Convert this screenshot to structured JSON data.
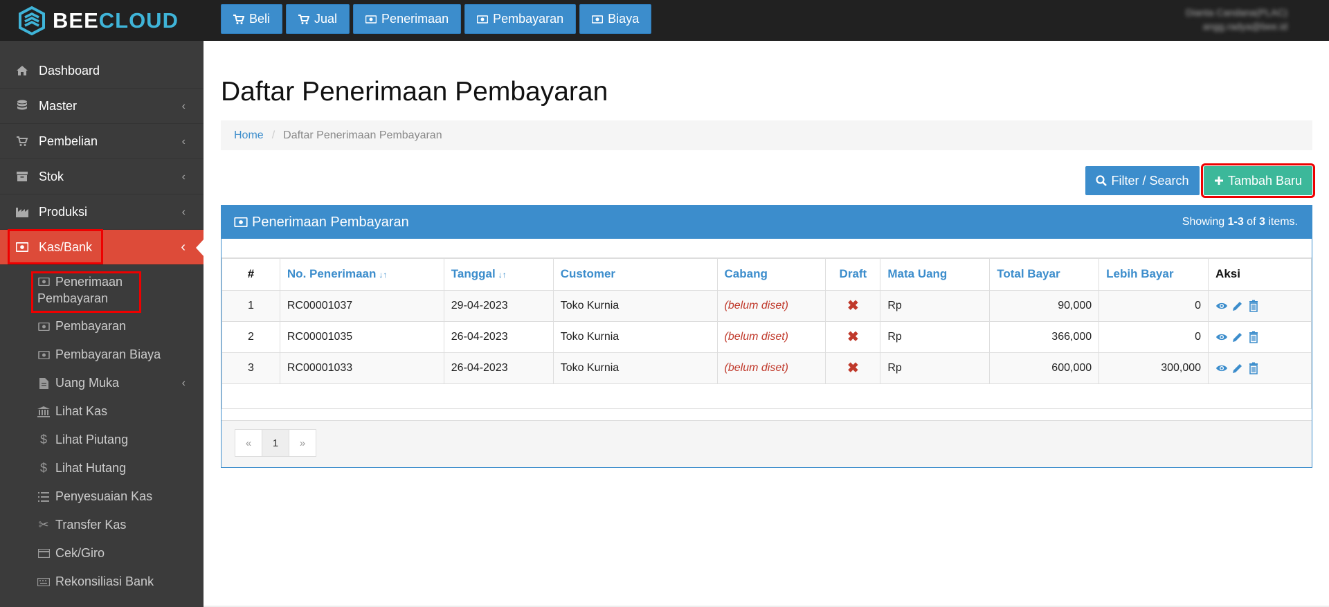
{
  "app": {
    "brand_part1": "BEE",
    "brand_part2": "CLOUD"
  },
  "topnav": [
    {
      "label": "Beli",
      "icon": "cart-icon"
    },
    {
      "label": "Jual",
      "icon": "cart-icon"
    },
    {
      "label": "Penerimaan",
      "icon": "money-icon"
    },
    {
      "label": "Pembayaran",
      "icon": "money-icon"
    },
    {
      "label": "Biaya",
      "icon": "money-icon"
    }
  ],
  "user": {
    "name": "Dianta Candana(PLAC)",
    "email": "angg.radya@bee.id"
  },
  "sidebar": {
    "items": [
      {
        "label": "Dashboard",
        "icon": "home-icon"
      },
      {
        "label": "Master",
        "icon": "database-icon"
      },
      {
        "label": "Pembelian",
        "icon": "cart-icon"
      },
      {
        "label": "Stok",
        "icon": "archive-icon"
      },
      {
        "label": "Produksi",
        "icon": "factory-icon"
      },
      {
        "label": "Kas/Bank",
        "icon": "money-icon"
      }
    ],
    "subitems": [
      {
        "label": "Penerimaan Pembayaran",
        "line1": "Penerimaan",
        "line2": "Pembayaran",
        "icon": "money-icon"
      },
      {
        "label": "Pembayaran",
        "icon": "money-icon"
      },
      {
        "label": "Pembayaran Biaya",
        "icon": "money-icon"
      },
      {
        "label": "Uang Muka",
        "icon": "file-icon"
      },
      {
        "label": "Lihat Kas",
        "icon": "bank-icon"
      },
      {
        "label": "Lihat Piutang",
        "icon": "dollar-icon"
      },
      {
        "label": "Lihat Hutang",
        "icon": "dollar-icon"
      },
      {
        "label": "Penyesuaian Kas",
        "icon": "list-icon"
      },
      {
        "label": "Transfer Kas",
        "icon": "scissors-icon"
      },
      {
        "label": "Cek/Giro",
        "icon": "card-icon"
      },
      {
        "label": "Rekonsiliasi Bank",
        "icon": "keyboard-icon"
      }
    ]
  },
  "page": {
    "title": "Daftar Penerimaan Pembayaran",
    "breadcrumb_home": "Home",
    "breadcrumb_current": "Daftar Penerimaan Pembayaran",
    "filter_label": "Filter / Search",
    "add_label": "Tambah Baru"
  },
  "panel": {
    "title": "Penerimaan Pembayaran",
    "showing_prefix": "Showing ",
    "showing_range": "1-3",
    "showing_mid": " of ",
    "showing_total": "3",
    "showing_suffix": " items."
  },
  "table": {
    "headers": [
      "#",
      "No. Penerimaan",
      "Tanggal",
      "Customer",
      "Cabang",
      "Draft",
      "Mata Uang",
      "Total Bayar",
      "Lebih Bayar",
      "Aksi"
    ],
    "rows": [
      {
        "no": "1",
        "nomor": "RC00001037",
        "tanggal": "29-04-2023",
        "customer": "Toko Kurnia",
        "cabang": "(belum diset)",
        "draft": "✖",
        "mata_uang": "Rp",
        "total": "90,000",
        "lebih": "0"
      },
      {
        "no": "2",
        "nomor": "RC00001035",
        "tanggal": "26-04-2023",
        "customer": "Toko Kurnia",
        "cabang": "(belum diset)",
        "draft": "✖",
        "mata_uang": "Rp",
        "total": "366,000",
        "lebih": "0"
      },
      {
        "no": "3",
        "nomor": "RC00001033",
        "tanggal": "26-04-2023",
        "customer": "Toko Kurnia",
        "cabang": "(belum diset)",
        "draft": "✖",
        "mata_uang": "Rp",
        "total": "600,000",
        "lebih": "300,000"
      }
    ]
  },
  "pagination": {
    "prev": "«",
    "current": "1",
    "next": "»"
  },
  "colors": {
    "primary": "#3c8dcc",
    "success": "#3cb89a",
    "danger": "#dd4b39",
    "sidebar": "#3b3b3b",
    "topbar": "#212121"
  }
}
